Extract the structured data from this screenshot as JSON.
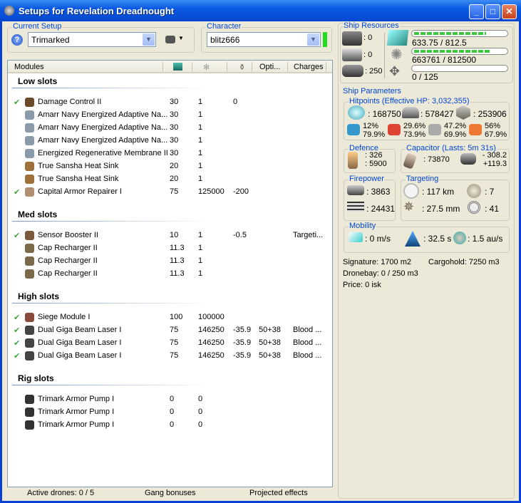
{
  "window": {
    "title": "Setups for Revelation Dreadnought"
  },
  "setup": {
    "label": "Current Setup",
    "value": "Trimarked"
  },
  "character": {
    "label": "Character",
    "value": "blitz666",
    "status_color": "#22dd22"
  },
  "columns": [
    "Modules",
    "",
    "",
    "",
    "Opti...",
    "Charges"
  ],
  "sections": [
    {
      "title": "Low slots",
      "rows": [
        {
          "active": true,
          "name": "Damage Control II",
          "c1": "30",
          "c2": "1",
          "c3": "0",
          "c4": "",
          "c5": "",
          "icon": "#6b4a2a"
        },
        {
          "active": false,
          "name": "Amarr Navy Energized Adaptive Na...",
          "c1": "30",
          "c2": "1",
          "c3": "",
          "c4": "",
          "c5": "",
          "icon": "#8a9aa8"
        },
        {
          "active": false,
          "name": "Amarr Navy Energized Adaptive Na...",
          "c1": "30",
          "c2": "1",
          "c3": "",
          "c4": "",
          "c5": "",
          "icon": "#8a9aa8"
        },
        {
          "active": false,
          "name": "Amarr Navy Energized Adaptive Na...",
          "c1": "30",
          "c2": "1",
          "c3": "",
          "c4": "",
          "c5": "",
          "icon": "#8a9aa8"
        },
        {
          "active": false,
          "name": "Energized Regenerative Membrane II",
          "c1": "30",
          "c2": "1",
          "c3": "",
          "c4": "",
          "c5": "",
          "icon": "#8a9aa8"
        },
        {
          "active": false,
          "name": "True Sansha Heat Sink",
          "c1": "20",
          "c2": "1",
          "c3": "",
          "c4": "",
          "c5": "",
          "icon": "#a0703a"
        },
        {
          "active": false,
          "name": "True Sansha Heat Sink",
          "c1": "20",
          "c2": "1",
          "c3": "",
          "c4": "",
          "c5": "",
          "icon": "#a0703a"
        },
        {
          "active": true,
          "name": "Capital Armor Repairer I",
          "c1": "75",
          "c2": "125000",
          "c3": "-200",
          "c4": "",
          "c5": "",
          "icon": "#b09070"
        }
      ]
    },
    {
      "title": "Med slots",
      "rows": [
        {
          "active": true,
          "name": "Sensor Booster II",
          "c1": "10",
          "c2": "1",
          "c3": "-0.5",
          "c4": "",
          "c5": "Targeti...",
          "icon": "#7a5a3a"
        },
        {
          "active": false,
          "name": "Cap Recharger II",
          "c1": "11.3",
          "c2": "1",
          "c3": "",
          "c4": "",
          "c5": "",
          "icon": "#7a6a4a"
        },
        {
          "active": false,
          "name": "Cap Recharger II",
          "c1": "11.3",
          "c2": "1",
          "c3": "",
          "c4": "",
          "c5": "",
          "icon": "#7a6a4a"
        },
        {
          "active": false,
          "name": "Cap Recharger II",
          "c1": "11.3",
          "c2": "1",
          "c3": "",
          "c4": "",
          "c5": "",
          "icon": "#7a6a4a"
        }
      ]
    },
    {
      "title": "High slots",
      "rows": [
        {
          "active": true,
          "name": "Siege Module I",
          "c1": "100",
          "c2": "100000",
          "c3": "",
          "c4": "",
          "c5": "",
          "icon": "#8a4a3a"
        },
        {
          "active": true,
          "name": "Dual Giga Beam Laser I",
          "c1": "75",
          "c2": "146250",
          "c3": "-35.9",
          "c4": "50+38",
          "c5": "Blood ...",
          "icon": "#444"
        },
        {
          "active": true,
          "name": "Dual Giga Beam Laser I",
          "c1": "75",
          "c2": "146250",
          "c3": "-35.9",
          "c4": "50+38",
          "c5": "Blood ...",
          "icon": "#444"
        },
        {
          "active": true,
          "name": "Dual Giga Beam Laser I",
          "c1": "75",
          "c2": "146250",
          "c3": "-35.9",
          "c4": "50+38",
          "c5": "Blood ...",
          "icon": "#444"
        }
      ]
    },
    {
      "title": "Rig slots",
      "rows": [
        {
          "active": false,
          "name": "Trimark Armor Pump I",
          "c1": "0",
          "c2": "0",
          "c3": "",
          "c4": "",
          "c5": "",
          "icon": "#333"
        },
        {
          "active": false,
          "name": "Trimark Armor Pump I",
          "c1": "0",
          "c2": "0",
          "c3": "",
          "c4": "",
          "c5": "",
          "icon": "#333"
        },
        {
          "active": false,
          "name": "Trimark Armor Pump I",
          "c1": "0",
          "c2": "0",
          "c3": "",
          "c4": "",
          "c5": "",
          "icon": "#333"
        }
      ]
    }
  ],
  "status": {
    "drones": "Active drones: 0 / 5",
    "gang": "Gang bonuses",
    "projected": "Projected effects"
  },
  "resources": {
    "label": "Ship Resources",
    "turrets": ": 0",
    "launchers": ": 0",
    "calibration": ": 250",
    "cpu": "633.75 / 812.5",
    "cpu_fraction": 0.78,
    "powergrid": "663761 / 812500",
    "powergrid_fraction": 0.82,
    "drone_bw": "0 / 125",
    "drone_bw_fraction": 0
  },
  "params": {
    "label": "Ship Parameters",
    "hp_label": "Hitpoints (Effective HP: 3,032,355)",
    "shield": ": 168750",
    "armor": ": 578427",
    "structure": ": 253906",
    "resists": [
      [
        "12%",
        "79.9%"
      ],
      [
        "29.6%",
        "73.9%"
      ],
      [
        "47.2%",
        "69.9%"
      ],
      [
        "56%",
        "67.9%"
      ]
    ],
    "defence_label": "Defence",
    "def1": ": 326",
    "def2": ": 5900",
    "cap_label": "Capacitor (Lasts: 5m 31s)",
    "cap": ": 73870",
    "cap_use": "- 308.2",
    "cap_rech": "+119.3",
    "fire_label": "Firepower",
    "dps": ": 3863",
    "volley": ": 24431",
    "targ_label": "Targeting",
    "range": ": 117 km",
    "max_targets": ": 7",
    "scan_res": ": 27.5 mm",
    "sensor": ": 41",
    "mob_label": "Mobility",
    "speed": ": 0 m/s",
    "align": ": 32.5 s",
    "warp": ": 1.5 au/s",
    "signature": "Signature: 1700 m2",
    "cargo": "Cargohold: 7250 m3",
    "dronebay": "Dronebay: 0 / 250 m3",
    "price": "Price: 0 isk"
  }
}
